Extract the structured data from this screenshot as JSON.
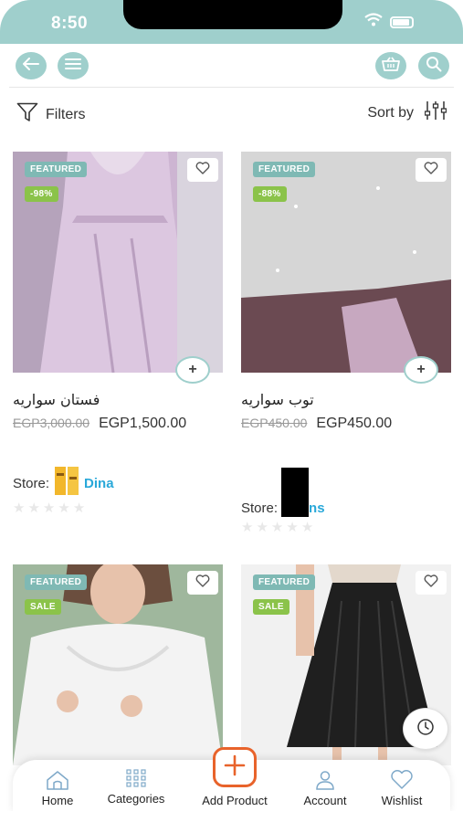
{
  "status_bar": {
    "time": "8:50"
  },
  "toolbar": {
    "back_icon": "arrow-left-icon",
    "menu_icon": "hamburger-icon",
    "cart_icon": "basket-icon",
    "search_icon": "search-icon"
  },
  "filter_bar": {
    "filters_label": "Filters",
    "sort_label": "Sort by"
  },
  "products": [
    {
      "badge": "FEATURED",
      "discount": "-98%",
      "name": "فستان سواريه",
      "old_price": "EGP3,000.00",
      "new_price": "EGP1,500.00",
      "store_label": "Store:",
      "store_name": "Dina",
      "image_color": "#d7c3dc"
    },
    {
      "badge": "FEATURED",
      "discount": "-88%",
      "name": "توب سواريه",
      "old_price": "EGP450.00",
      "new_price": "EGP450.00",
      "store_label": "Store:",
      "store_name": "ns",
      "image_color": "#c8c8c8"
    },
    {
      "badge": "FEATURED",
      "tag": "SALE",
      "image_color": "#ececec"
    },
    {
      "badge": "FEATURED",
      "tag": "SALE",
      "image_color": "#e9e9e9"
    }
  ],
  "colors": {
    "accent": "#9fcfcc",
    "add_product": "#e8632b",
    "store_link": "#29a8d9",
    "sale_green": "#8bc34a"
  },
  "bottom_nav": {
    "home": "Home",
    "categories": "Categories",
    "add_product": "Add Product",
    "account": "Account",
    "wishlist": "Wishlist"
  }
}
